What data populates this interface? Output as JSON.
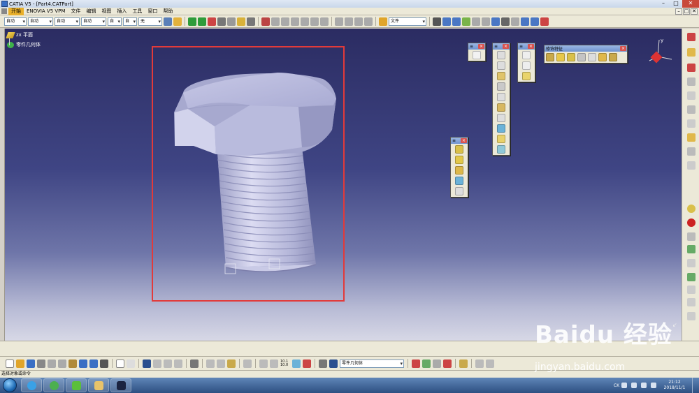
{
  "window": {
    "title": "CATIA V5 - [Part4.CATPart]",
    "minimize": "–",
    "maximize": "□",
    "close": "✕"
  },
  "menu": {
    "items": [
      "开始",
      "ENOVIA V5 VPM",
      "文件",
      "编辑",
      "视图",
      "插入",
      "工具",
      "窗口",
      "帮助"
    ]
  },
  "top_toolbar": {
    "dropdowns": [
      "自动",
      "自动",
      "自动",
      "自动",
      "自",
      "自",
      "无"
    ],
    "layer_dropdown": "文件"
  },
  "tree": {
    "items": [
      "zx 平面",
      "零件几何体"
    ]
  },
  "floating_toolbars": {
    "dress_up_title": "修饰特征"
  },
  "bottom_toolbar": {
    "body_dropdown": "零件几何体",
    "scale_label": "10.1\n10.0"
  },
  "status": {
    "command_prompt": "选择对象或命令"
  },
  "taskbar": {
    "ime": "CK",
    "time": "21:12",
    "date": "2018/11/1"
  },
  "watermark": {
    "brand": "Baidu 经验",
    "url": "jingyan.baidu.com"
  },
  "colors": {
    "selection_border": "#e23a3a",
    "active_menu": "#e9b02a",
    "bolt": "#b7b9d9"
  }
}
